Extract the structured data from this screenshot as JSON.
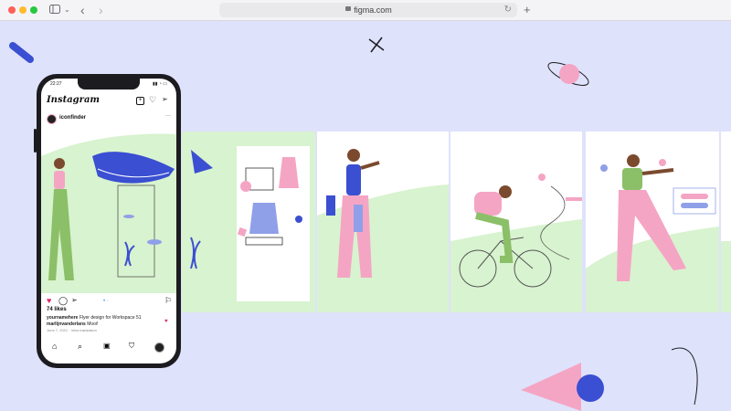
{
  "browser": {
    "url": "figma.com",
    "traffic_colors": [
      "#ff5f57",
      "#febc2e",
      "#28c840"
    ],
    "icons": [
      "sidebar-icon",
      "chevron-down-icon",
      "back-arrow-icon",
      "forward-arrow-icon",
      "lock-icon",
      "reload-icon",
      "new-tab-icon"
    ]
  },
  "phone": {
    "time": "22:27",
    "app_name": "Instagram",
    "account": "iconfinder",
    "likes": "74 likes",
    "caption_user": "yournamehere",
    "caption_text": "Flyer design for Workspace 51",
    "comment_user": "marlijnvanderlans",
    "comment_text": "Mooi!",
    "date": "June 7, 2021",
    "translation": "View translation"
  },
  "colors": {
    "canvas": "#dfe2fb",
    "mint": "#d8f3cf",
    "pink": "#f5a5c4",
    "blue": "#3a4fd1",
    "green": "#8bbf68",
    "skin": "#7b4a2e"
  }
}
